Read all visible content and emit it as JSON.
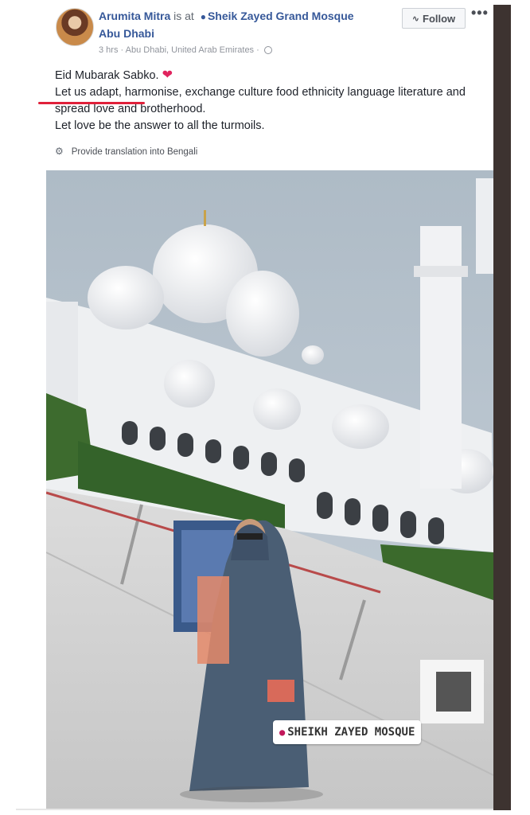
{
  "post": {
    "author_name": "Arumita Mitra",
    "is_at_text": "is at",
    "place_line1": "Sheik Zayed Grand Mosque",
    "place_line2": "Abu Dhabi",
    "time": "3 hrs",
    "meta_sep": " · ",
    "location": "Abu Dhabi, United Arab Emirates",
    "follow_label": "Follow",
    "more_label": "•••",
    "text_line1": "Eid Mubarak Sabko.",
    "text_line2": "Let us adapt, harmonise, exchange culture food ethnicity language literature and spread love and brotherhood.",
    "text_line3": "Let love be the answer to all the turmoils.",
    "translate_label": "Provide translation into Bengali"
  },
  "photo": {
    "sticker_text": "SHEIKH ZAYED MOSQUE"
  },
  "icons": {
    "pin": "map-pin-icon",
    "globe": "globe-icon",
    "rss": "rss-icon",
    "heart": "heart-icon",
    "gear": "gear-icon"
  },
  "colors": {
    "link": "#365899",
    "heart": "#e0245e",
    "underline": "#e0203a"
  }
}
